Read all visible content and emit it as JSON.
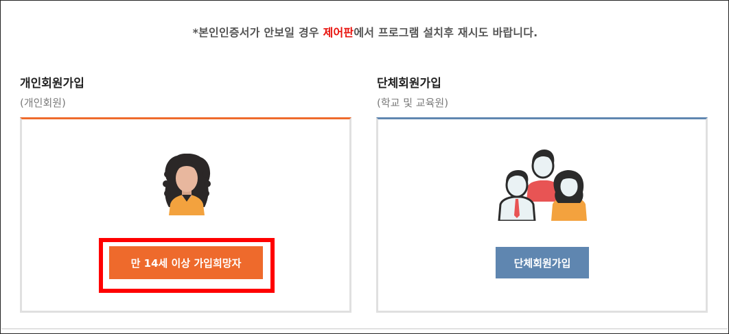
{
  "notice": {
    "prefix": "*본인인증서가 안보일 경우 ",
    "highlight": "제어판",
    "suffix": "에서 프로그램 설치후 재시도 바랍니다."
  },
  "personal": {
    "title": "개인회원가입",
    "subtitle": "(개인회원)",
    "button_label": "만 14세 이상 가입희망자",
    "icon": "woman-avatar-icon",
    "accent_color": "#ee6a2c"
  },
  "group": {
    "title": "단체회원가입",
    "subtitle": "(학교 및 교육원)",
    "button_label": "단체회원가입",
    "icon": "group-people-icon",
    "accent_color": "#5f86b0"
  },
  "highlight_color": "#ff0000"
}
